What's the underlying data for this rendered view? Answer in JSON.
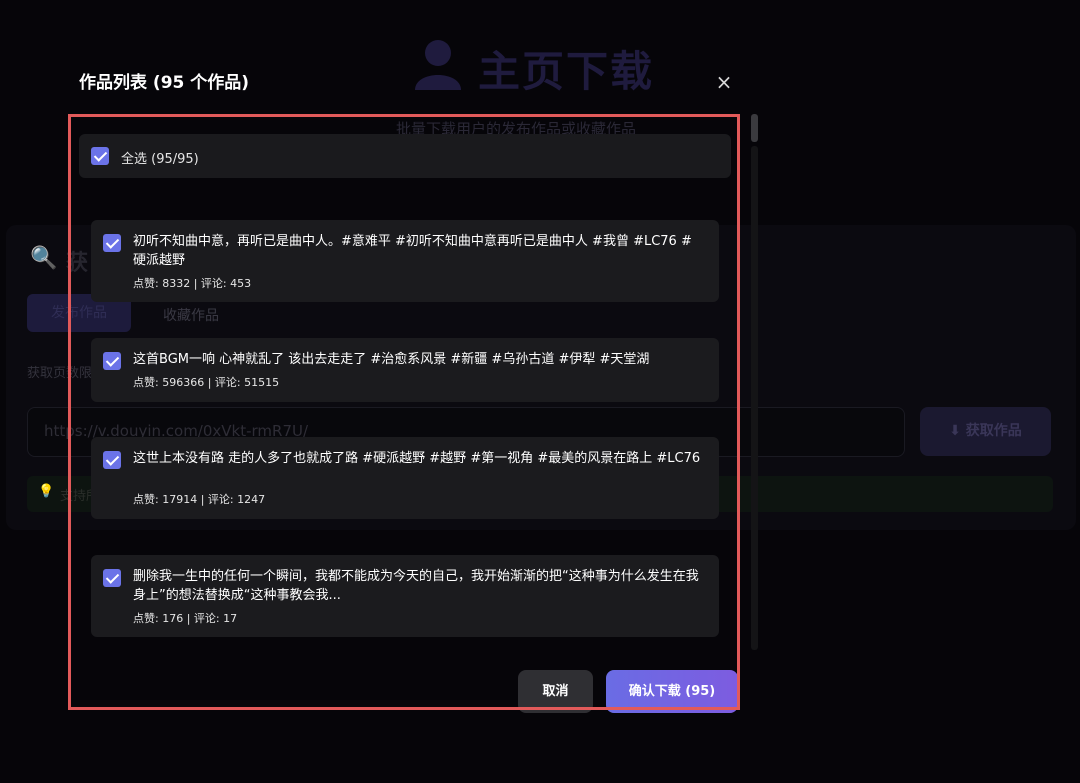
{
  "background": {
    "title": "主页下载",
    "subtitle": "批量下载用户的发布作品或收藏作品",
    "card_title": "获",
    "tabs": [
      "发布作品",
      "收藏作品"
    ],
    "pages_label": "获取页数限",
    "url_value": "https://v.douyin.com/0xVkt-rmR7U/",
    "fetch_button": "获取作品",
    "hint_text": "支持所",
    "icons": {
      "logo": "user-icon",
      "search": "search-icon",
      "hint": "lightbulb-icon"
    }
  },
  "modal": {
    "title": "作品列表 (95 个作品)",
    "close_label": "×",
    "select_all_label": "全选 (95/95)",
    "select_all_checked": true,
    "items": [
      {
        "checked": true,
        "text": "初听不知曲中意，再听已是曲中人。#意难平 #初听不知曲中意再听已是曲中人 #我曾 #LC76 #硬派越野",
        "stats": "点赞: 8332 | 评论: 453"
      },
      {
        "checked": true,
        "text": "这首BGM一响 心神就乱了 该出去走走了 #治愈系风景 #新疆 #乌孙古道 #伊犁 #天堂湖",
        "stats": "点赞: 596366 | 评论: 51515"
      },
      {
        "checked": true,
        "text": "这世上本没有路 走的人多了也就成了路 #硬派越野 #越野 #第一视角 #最美的风景在路上 #LC76",
        "stats": "点赞: 17914 | 评论: 1247"
      },
      {
        "checked": true,
        "text": "删除我一生中的任何一个瞬间，我都不能成为今天的自己，我开始渐渐的把“这种事为什么发生在我身上”的想法替换成“这种事教会我...",
        "stats": "点赞: 176 | 评论: 17"
      }
    ],
    "cancel_label": "取消",
    "confirm_label": "确认下载 (95)"
  },
  "colors": {
    "accent": "#6b73e8",
    "highlight_border": "#e25a5a",
    "item_bg": "#1b1b1e"
  }
}
